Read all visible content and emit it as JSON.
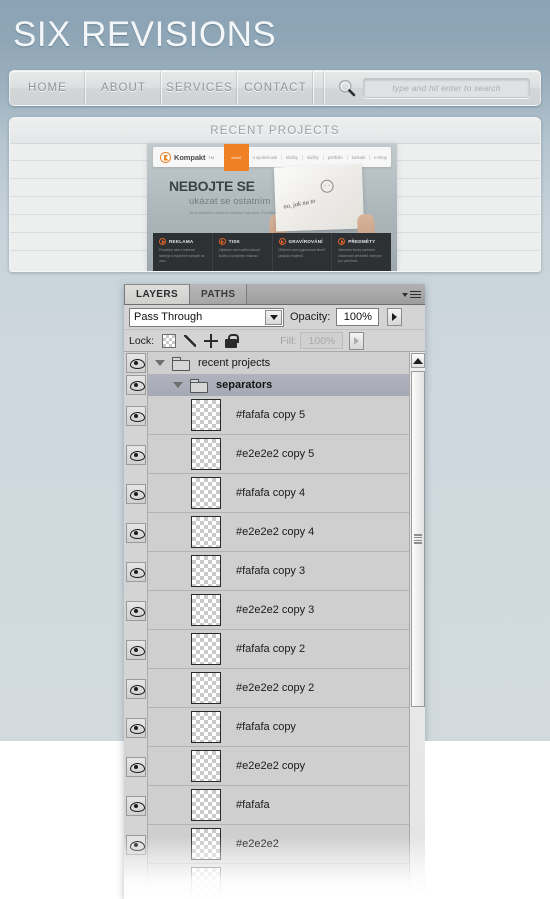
{
  "site": {
    "title": "SIX REVISIONS",
    "nav": [
      {
        "label": "HOME"
      },
      {
        "label": "ABOUT"
      },
      {
        "label": "SERVICES"
      },
      {
        "label": "CONTACT"
      }
    ],
    "search": {
      "icon": "search-icon",
      "placeholder": "type and hit enter to search",
      "value": ""
    },
    "recent_projects": {
      "title": "RECENT PROJECTS",
      "thumbnail": {
        "logo_text": "Kompakt",
        "logo_tm": "TM",
        "nav_active": "domů",
        "nav_links": [
          "o společnosti",
          "služby",
          "služby",
          "portfolio",
          "kontakt",
          "e-shop"
        ],
        "hero_heading": "NEBOJTE SE",
        "hero_subheading": "ukázat se ostatním",
        "hero_paragraph": "Jsme zkušená a moderní reklamní agentura. Pomůžeme vám.",
        "paper_script": "no, jak na to",
        "features": [
          {
            "title": "REKLAMA",
            "body": "Poradíme vám s reklamní strategií a vytvoříme kampaň na míru."
          },
          {
            "title": "TISK",
            "body": "Zajistíme vám kvalitní tiskové služby a kompletní realizaci."
          },
          {
            "title": "GRAVÍROVÁNÍ",
            "body": "Můžeme vám vygravírovat téměř jakýkoliv materiál."
          },
          {
            "title": "PŘEDMĚTY",
            "body": "Nabízíme široký sortiment reklamních předmětů určených pro vaši firmu."
          }
        ]
      }
    }
  },
  "photoshop": {
    "tabs": [
      {
        "label": "LAYERS",
        "active": true
      },
      {
        "label": "PATHS",
        "active": false
      }
    ],
    "menu_icon": "panel-menu-icon",
    "blend_mode": "Pass Through",
    "opacity_label": "Opacity:",
    "opacity_value": "100%",
    "lock_label": "Lock:",
    "lock_icons": [
      "lock-transparent-pixels-icon",
      "lock-image-pixels-icon",
      "lock-position-icon",
      "lock-all-icon"
    ],
    "fill_label": "Fill:",
    "fill_value": "100%",
    "rows": [
      {
        "kind": "group",
        "name": "recent projects",
        "indent": 0,
        "expanded": true,
        "selected": false,
        "visible": true
      },
      {
        "kind": "group",
        "name": "separators",
        "indent": 1,
        "expanded": true,
        "selected": true,
        "visible": true
      },
      {
        "kind": "layer",
        "name": "#fafafa copy 5",
        "indent": 2,
        "visible": true
      },
      {
        "kind": "layer",
        "name": "#e2e2e2 copy 5",
        "indent": 2,
        "visible": true
      },
      {
        "kind": "layer",
        "name": "#fafafa copy 4",
        "indent": 2,
        "visible": true
      },
      {
        "kind": "layer",
        "name": "#e2e2e2 copy 4",
        "indent": 2,
        "visible": true
      },
      {
        "kind": "layer",
        "name": "#fafafa copy 3",
        "indent": 2,
        "visible": true
      },
      {
        "kind": "layer",
        "name": "#e2e2e2 copy 3",
        "indent": 2,
        "visible": true
      },
      {
        "kind": "layer",
        "name": "#fafafa copy 2",
        "indent": 2,
        "visible": true
      },
      {
        "kind": "layer",
        "name": "#e2e2e2 copy 2",
        "indent": 2,
        "visible": true
      },
      {
        "kind": "layer",
        "name": "#fafafa copy",
        "indent": 2,
        "visible": true
      },
      {
        "kind": "layer",
        "name": "#e2e2e2 copy",
        "indent": 2,
        "visible": true
      },
      {
        "kind": "layer",
        "name": "#fafafa",
        "indent": 2,
        "visible": true
      },
      {
        "kind": "layer",
        "name": "#e2e2e2",
        "indent": 2,
        "visible": true
      }
    ],
    "scrollbar": {
      "up_icon": "scroll-up-arrow-icon",
      "down_icon": "scroll-down-arrow-icon"
    }
  },
  "colors": {
    "header_blue": "#8ba3b4",
    "page_blue": "#d2dade",
    "accent_orange": "#ef8024",
    "panel_gray": "#d4d4d4",
    "row_gray": "#cfcfcf",
    "selection_blue": "#a9acb7"
  }
}
